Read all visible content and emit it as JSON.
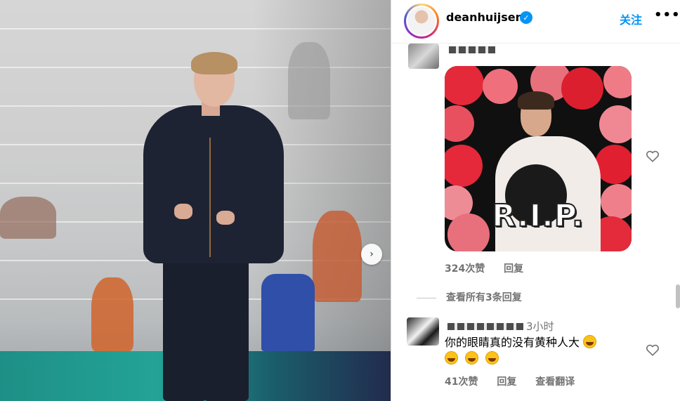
{
  "post": {
    "username": "deanhuijsen",
    "verified_badge": "✓",
    "follow_label": "关注",
    "more_label": "•••",
    "next_icon": "›"
  },
  "comments": [
    {
      "author": "",
      "gif_text": "R.I.P.",
      "likes": "324次赞",
      "reply_label": "回复",
      "view_replies": "查看所有3条回复"
    },
    {
      "author": "",
      "time": "3小时",
      "text": "你的眼睛真的没有黄种人大",
      "emoji_count_inline": 1,
      "emoji_count_next_line": 3,
      "likes": "41次赞",
      "reply_label": "回复",
      "translate_label": "查看翻译"
    }
  ],
  "colors": {
    "accent": "#0095f6",
    "muted": "#737373"
  },
  "icons": [
    "verified-badge-icon",
    "more-options-icon",
    "next-arrow-icon",
    "heart-icon",
    "laughing-emoji-icon"
  ]
}
